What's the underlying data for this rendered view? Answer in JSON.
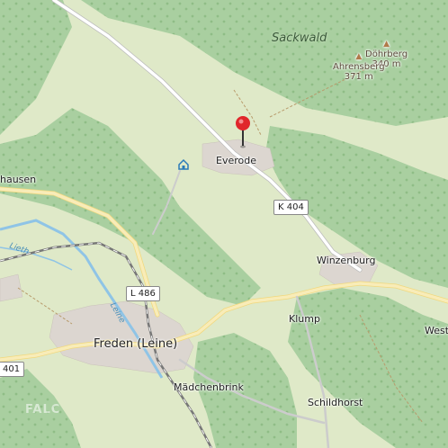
{
  "map": {
    "forest_area": "Sackwald",
    "peaks": [
      {
        "name": "Döhrberg",
        "elevation": "340 m"
      },
      {
        "name": "Ahrensberg",
        "elevation": "371 m"
      }
    ],
    "places": {
      "everode": "Everode",
      "winzenburg": "Winzenburg",
      "klump": "Klump",
      "freden": "Freden (Leine)",
      "maedchenbrink": "Mädchenbrink",
      "schildhorst": "Schildhorst",
      "hausen": "hausen",
      "west": "West"
    },
    "roads": {
      "k404": "K 404",
      "l486": "L 486",
      "r401": "401"
    },
    "water": {
      "lieth": "Lieth",
      "leine": "Leine"
    },
    "marker": {
      "label": "selected location pin",
      "color": "#e0262b"
    },
    "watermark": "FALC",
    "colors": {
      "forest": "#a9cfa0",
      "meadow": "#dfe9c8",
      "road_major": "#f5e6a3",
      "water": "#8fc4e6",
      "railway": "#666666"
    }
  }
}
